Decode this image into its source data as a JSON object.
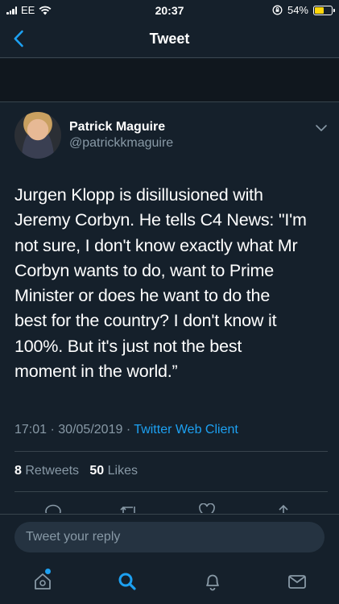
{
  "status_bar": {
    "carrier": "EE",
    "time": "20:37",
    "battery_percent": "54%",
    "battery_level": 0.54
  },
  "nav": {
    "title": "Tweet"
  },
  "tweet": {
    "author_name": "Patrick Maguire",
    "author_handle": "@patrickkmaguire",
    "text_lines": [
      "Jurgen Klopp is disillusioned with",
      "Jeremy Corbyn. He tells C4 News: \"I'm",
      "not sure, I don't know exactly what Mr",
      "Corbyn wants to do, want to Prime",
      "Minister or does he want to do the",
      "best for the country? I don't know it",
      "100%. But it's just not the best",
      "moment in the world.”"
    ],
    "time": "17:01",
    "date": "30/05/2019",
    "separator": "·",
    "client": "Twitter Web Client",
    "retweet_count": "8",
    "retweet_label": "Retweets",
    "like_count": "50",
    "like_label": "Likes"
  },
  "reply": {
    "placeholder": "Tweet your reply"
  },
  "tab_bar": {
    "items": [
      "home-icon",
      "search-icon",
      "notifications-icon",
      "messages-icon"
    ],
    "active": "search-icon"
  },
  "colors": {
    "background": "#15202b",
    "accent": "#1da1f2",
    "secondary_text": "#8899a6",
    "battery": "#ffd60a"
  }
}
